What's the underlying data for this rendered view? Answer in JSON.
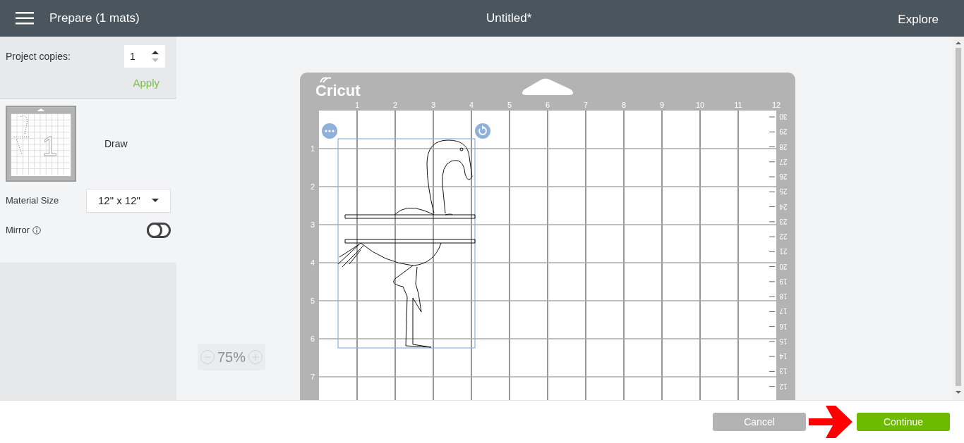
{
  "header": {
    "title": "Prepare (1 mats)",
    "document": "Untitled*",
    "link": "Explore"
  },
  "sidebar": {
    "copies_label": "Project copies:",
    "copies_value": "1",
    "apply": "Apply",
    "mats": [
      {
        "number": "1",
        "label": "Draw",
        "selected": true
      }
    ],
    "material_size_label": "Material Size",
    "material_size": "12\" x 12\"",
    "mirror_label": "Mirror",
    "mirror": {
      "on": false
    }
  },
  "zoom": {
    "value": "75%"
  },
  "mat": {
    "logo": "Cricut",
    "x_labels": [
      "1",
      "2",
      "3",
      "4",
      "5",
      "6",
      "7",
      "8",
      "9",
      "10",
      "11",
      "12"
    ],
    "y_labels": [
      "1",
      "2",
      "3",
      "4",
      "5",
      "6",
      "7"
    ],
    "cm_labels": [
      "30",
      "29",
      "28",
      "27",
      "26",
      "25",
      "24",
      "23",
      "22",
      "21",
      "20",
      "19",
      "18",
      "17",
      "16",
      "15",
      "14",
      "13",
      "12"
    ]
  },
  "buttons": [
    {
      "label": "Cancel",
      "kind": "secondary"
    },
    {
      "label": "Continue",
      "kind": "primary"
    }
  ]
}
